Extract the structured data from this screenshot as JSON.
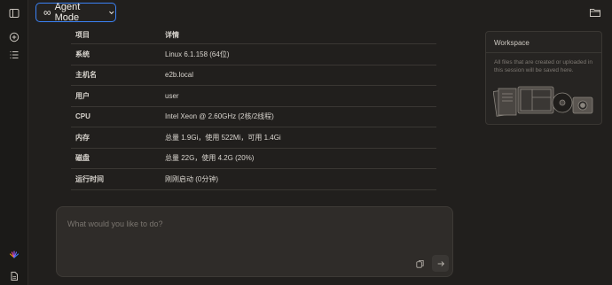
{
  "header": {
    "mode_label": "Agent Mode",
    "mode_icon": "infinity-icon"
  },
  "table": {
    "columns": [
      "项目",
      "详情"
    ],
    "rows": [
      {
        "key": "系统",
        "value": "Linux 6.1.158 (64位)"
      },
      {
        "key": "主机名",
        "value": "e2b.local"
      },
      {
        "key": "用户",
        "value": "user"
      },
      {
        "key": "CPU",
        "value": "Intel Xeon @ 2.60GHz (2核/2线程)"
      },
      {
        "key": "内存",
        "value": "总量 1.9Gi，使用 522Mi，可用 1.4Gi"
      },
      {
        "key": "磁盘",
        "value": "总量 22G，使用 4.2G (20%)"
      },
      {
        "key": "运行时间",
        "value": "刚刚启动 (0分钟)"
      }
    ]
  },
  "workspace": {
    "title": "Workspace",
    "description": "All files that are created or uploaded in this session will be saved here."
  },
  "composer": {
    "placeholder": "What would you like to do?"
  },
  "colors": {
    "accent": "#3b82f6",
    "background": "#211f1d"
  }
}
